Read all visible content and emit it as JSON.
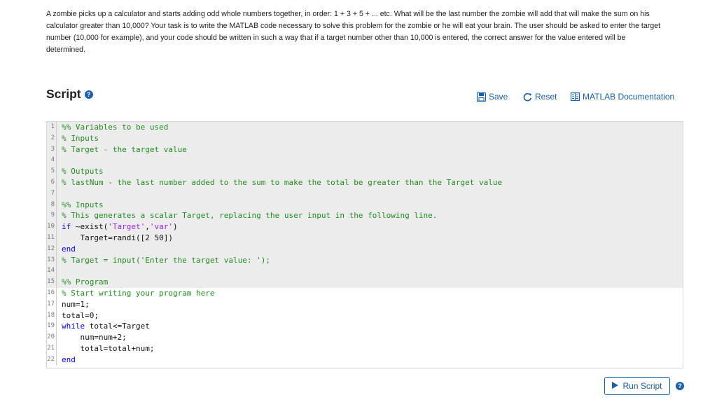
{
  "problem_text": "A zombie picks up a calculator and starts adding odd whole numbers together, in order: 1 + 3 + 5 + ... etc. What will be the last number the zombie will add that will make the sum on his calculator greater than 10,000? Your task is to write the MATLAB code necessary to solve this problem for the zombie or he will eat your brain. The user should be asked to enter the target number (10,000 for example), and your code should be written in such a way that if a target number other than 10,000 is entered, the correct answer for the value entered will be determined.",
  "script": {
    "title": "Script",
    "help_icon": "?",
    "save_label": "Save",
    "reset_label": "Reset",
    "docs_label": "MATLAB Documentation"
  },
  "run": {
    "label": "Run Script",
    "help_icon": "?"
  },
  "editor": {
    "lines": [
      {
        "num": "1",
        "text": "%% Variables to be used",
        "locked": true
      },
      {
        "num": "2",
        "text": "% Inputs",
        "locked": true
      },
      {
        "num": "3",
        "text": "% Target - the target value",
        "locked": true
      },
      {
        "num": "4",
        "text": "",
        "locked": true
      },
      {
        "num": "5",
        "text": "% Outputs",
        "locked": true
      },
      {
        "num": "6",
        "text": "% lastNum - the last number added to the sum to make the total be greater than the Target value",
        "locked": true
      },
      {
        "num": "7",
        "text": "",
        "locked": true
      },
      {
        "num": "8",
        "text": "%% Inputs",
        "locked": true
      },
      {
        "num": "9",
        "text": "% This generates a scalar Target, replacing the user input in the following line.",
        "locked": true
      },
      {
        "num": "10",
        "text": "if ~exist('Target','var')",
        "locked": true
      },
      {
        "num": "11",
        "text": "    Target=randi([2 50])",
        "locked": true
      },
      {
        "num": "12",
        "text": "end",
        "locked": true
      },
      {
        "num": "13",
        "text": "% Target = input('Enter the target value: ');",
        "locked": true
      },
      {
        "num": "14",
        "text": "",
        "locked": true
      },
      {
        "num": "15",
        "text": "%% Program",
        "locked": true
      },
      {
        "num": "16",
        "text": "% Start writing your program here",
        "locked": false
      },
      {
        "num": "17",
        "text": "num=1;",
        "locked": false
      },
      {
        "num": "18",
        "text": "total=0;",
        "locked": false
      },
      {
        "num": "19",
        "text": "while total<=Target",
        "locked": false
      },
      {
        "num": "20",
        "text": "    num=num+2;",
        "locked": false
      },
      {
        "num": "21",
        "text": "    total=total+num;",
        "locked": false
      },
      {
        "num": "22",
        "text": "end",
        "locked": false
      }
    ]
  },
  "colors": {
    "link": "#1a5ea8",
    "comment": "#228b22",
    "keyword": "#0000ff",
    "string": "#a020f0",
    "locked_bg": "#ececec"
  }
}
